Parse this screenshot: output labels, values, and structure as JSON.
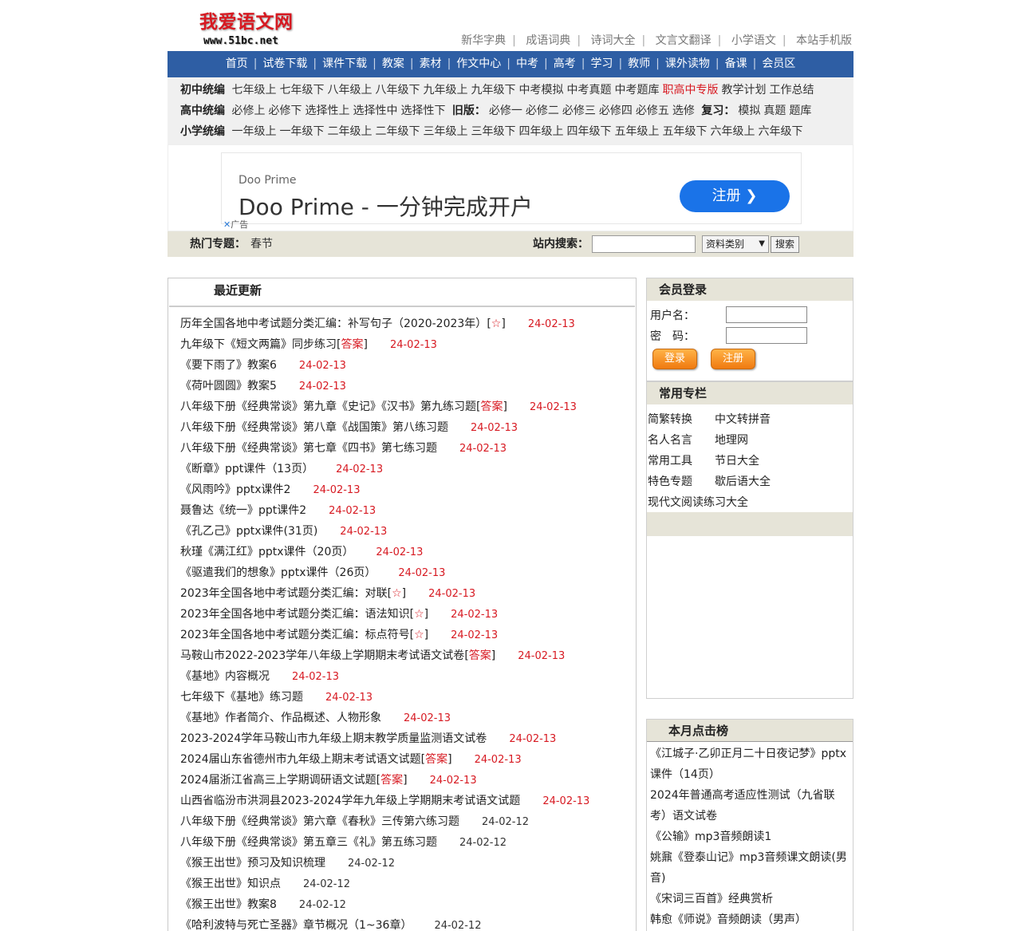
{
  "logo": {
    "title": "我爱语文网",
    "url": "www.51bc.net"
  },
  "top_links": [
    "新华字典",
    "成语词典",
    "诗词大全",
    "文言文翻译",
    "小学语文",
    "本站手机版"
  ],
  "main_nav": [
    "首页",
    "试卷下载",
    "课件下载",
    "教案",
    "素材",
    "作文中心",
    "中考",
    "高考",
    "学习",
    "教师",
    "课外读物",
    "备课",
    "会员区"
  ],
  "sub_nav": {
    "junior": {
      "label": "初中统编",
      "items": [
        "七年级上",
        "七年级下",
        "八年级上",
        "八年级下",
        "九年级上",
        "九年级下",
        "中考模拟",
        "中考真题",
        "中考题库",
        "职高中专版",
        "教学计划",
        "工作总结"
      ]
    },
    "senior": {
      "label": "高中统编",
      "items": [
        "必修上",
        "必修下",
        "选择性上",
        "选择性中",
        "选择性下"
      ],
      "old_label": "旧版：",
      "old_items": [
        "必修一",
        "必修二",
        "必修三",
        "必修四",
        "必修五",
        "选修"
      ],
      "review_label": "复习：",
      "review_items": [
        "模拟",
        "真题",
        "题库"
      ]
    },
    "primary": {
      "label": "小学统编",
      "items": [
        "一年级上",
        "一年级下",
        "二年级上",
        "二年级下",
        "三年级上",
        "三年级下",
        "四年级上",
        "四年级下",
        "五年级上",
        "五年级下",
        "六年级上",
        "六年级下"
      ]
    }
  },
  "ad": {
    "brand": "Doo Prime",
    "headline": "Doo Prime - 一分钟完成开户",
    "cta": "注册",
    "tag": "广告"
  },
  "hot_topics": {
    "label": "热门专题：",
    "value": "春节"
  },
  "site_search": {
    "label": "站内搜索：",
    "value": "",
    "select": "资料类别",
    "button": "搜索"
  },
  "latest": {
    "title": "最近更新",
    "items": [
      {
        "title": "历年全国各地中考试题分类汇编：补写句子（2020-2023年）",
        "tag": "☆",
        "date": "24-02-13"
      },
      {
        "title": "九年级下《短文两篇》同步练习",
        "tag": "答案",
        "date": "24-02-13"
      },
      {
        "title": "《要下雨了》教案6",
        "tag": "",
        "date": "24-02-13"
      },
      {
        "title": "《荷叶圆圆》教案5",
        "tag": "",
        "date": "24-02-13"
      },
      {
        "title": "八年级下册《经典常谈》第九章《史记》《汉书》第九练习题",
        "tag": "答案",
        "date": "24-02-13"
      },
      {
        "title": "八年级下册《经典常谈》第八章《战国策》第八练习题",
        "tag": "",
        "date": "24-02-13"
      },
      {
        "title": "八年级下册《经典常谈》第七章《四书》第七练习题",
        "tag": "",
        "date": "24-02-13"
      },
      {
        "title": "《断章》ppt课件（13页）",
        "tag": "",
        "date": "24-02-13"
      },
      {
        "title": "《风雨吟》pptx课件2",
        "tag": "",
        "date": "24-02-13"
      },
      {
        "title": "聂鲁达《统一》ppt课件2",
        "tag": "",
        "date": "24-02-13"
      },
      {
        "title": "《孔乙己》pptx课件(31页)",
        "tag": "",
        "date": "24-02-13"
      },
      {
        "title": "秋瑾《满江红》pptx课件（20页）",
        "tag": "",
        "date": "24-02-13"
      },
      {
        "title": "《驱遣我们的想象》pptx课件（26页）",
        "tag": "",
        "date": "24-02-13"
      },
      {
        "title": "2023年全国各地中考试题分类汇编：对联",
        "tag": "☆",
        "date": "24-02-13"
      },
      {
        "title": "2023年全国各地中考试题分类汇编：语法知识",
        "tag": "☆",
        "date": "24-02-13"
      },
      {
        "title": "2023年全国各地中考试题分类汇编：标点符号",
        "tag": "☆",
        "date": "24-02-13"
      },
      {
        "title": "马鞍山市2022-2023学年八年级上学期期末考试语文试卷",
        "tag": "答案",
        "date": "24-02-13"
      },
      {
        "title": "《基地》内容概况",
        "tag": "",
        "date": "24-02-13"
      },
      {
        "title": "七年级下《基地》练习题",
        "tag": "",
        "date": "24-02-13"
      },
      {
        "title": "《基地》作者简介、作品概述、人物形象",
        "tag": "",
        "date": "24-02-13"
      },
      {
        "title": "2023-2024学年马鞍山市九年级上期末教学质量监测语文试卷",
        "tag": "",
        "date": "24-02-13"
      },
      {
        "title": "2024届山东省德州市九年级上期末考试语文试题",
        "tag": "答案",
        "date": "24-02-13"
      },
      {
        "title": "2024届浙江省高三上学期调研语文试题",
        "tag": "答案",
        "date": "24-02-13"
      },
      {
        "title": "山西省临汾市洪洞县2023-2024学年九年级上学期期末考试语文试题",
        "tag": "",
        "date": "24-02-13"
      },
      {
        "title": "八年级下册《经典常谈》第六章《春秋》三传第六练习题",
        "tag": "",
        "date": "24-02-12"
      },
      {
        "title": "八年级下册《经典常谈》第五章三《礼》第五练习题",
        "tag": "",
        "date": "24-02-12"
      },
      {
        "title": "《猴王出世》预习及知识梳理",
        "tag": "",
        "date": "24-02-12"
      },
      {
        "title": "《猴王出世》知识点",
        "tag": "",
        "date": "24-02-12"
      },
      {
        "title": "《猴王出世》教案8",
        "tag": "",
        "date": "24-02-12"
      },
      {
        "title": "《哈利波特与死亡圣器》章节概况（1~36章）",
        "tag": "",
        "date": "24-02-12"
      }
    ]
  },
  "login": {
    "title": "会员登录",
    "username_label": "用户名：",
    "password_label": "密　码：",
    "login_btn": "登录",
    "register_btn": "注册"
  },
  "columns": {
    "title": "常用专栏",
    "items": [
      "简繁转换",
      "中文转拼音",
      "名人名言",
      "地理网",
      "常用工具",
      "节日大全",
      "特色专题",
      "歇后语大全",
      "现代文阅读练习大全"
    ]
  },
  "monthly_hot": {
    "title": "本月点击榜",
    "items": [
      "《江城子·乙卯正月二十日夜记梦》pptx课件（14页）",
      "2024年普通高考适应性测试（九省联考）语文试卷",
      "《公输》mp3音频朗读1",
      "姚鼐《登泰山记》mp3音频课文朗读(男音)",
      "《宋词三百首》经典赏析",
      "韩愈《师说》音频朗读（男声）"
    ]
  },
  "colors": {
    "nav_blue": "#2e5ea4",
    "accent_red": "#d71921",
    "band": "#e6e4d8",
    "ad_button": "#1a73e8",
    "orange_button": "#f07a10"
  }
}
